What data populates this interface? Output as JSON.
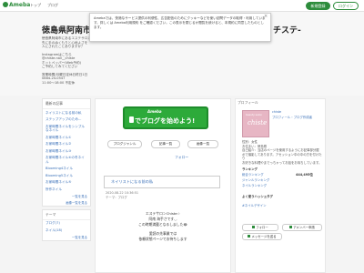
{
  "topbar": {
    "logo": "Ameba",
    "links": [
      "トップ",
      "ブログ"
    ],
    "register": "新規登録",
    "login": "ログイン"
  },
  "notice": {
    "text": "Amebaでは、快適なサービス提供の利便性、広告配信のためにクッキーなどを使い訪問データの取得・利用しています。詳しくは Ameba利用規約 をご確認ください。この表示を閉じるか閲覧を続けると、本規約に同意したものとします。",
    "close": "×"
  },
  "header": {
    "title_left": "徳島県阿南市に",
    "title_right": "チステ-",
    "desc": [
      "徳島県阿南市にあるエステサロン",
      "先に手のぬくもりと心地よさを",
      "人にされたことありますか？",
      "",
      "Instagramはこちら",
      "@chiste.nail__chiste",
      "ホットペッパー(Web予約)",
      "ご予約してみてください",
      "",
      "営業時間/月曜日定休日終日1日",
      "0884-24-0547",
      "11:00〜18:00 不定休"
    ]
  },
  "left": {
    "recent_head": "最新の記事",
    "recent": [
      "ネイリストになる前の私",
      "ステップアップのため…",
      "お家時間ネイルをシンプルなネイル",
      "お家時間ネイル①",
      "お家時間ネイル②",
      "お家時間ネイル③",
      "お家時間ネイル④の冬ネイル",
      "Blooming4ネイル",
      "Blooming5ネイル",
      "お家時間ネイル⑤",
      "所作ネイル"
    ],
    "recent_more": "一覧を見る",
    "recent_images": "画像一覧を見る",
    "theme_head": "テーマ",
    "themes": [
      "ブログ(7)",
      "ネイル(18)"
    ],
    "theme_more": "一覧を見る"
  },
  "center": {
    "banner_top": "Ameba",
    "banner_main": "でブログを始めよう!",
    "buttons": [
      "ブログジャンル",
      "記事一覧",
      "画像一覧"
    ],
    "follow": "フォロー",
    "post_title": "ネイリストになる前の私",
    "post_date": "2020-08-22 10:36:51",
    "post_theme": "テーマ：ブログ",
    "body": [
      "エステサロンChiste☆",
      "阿南 海手さです◡",
      "この時期満載となるしました😂",
      "",
      "愛読の先事業では",
      "依頼状態ページでお待ちします"
    ]
  },
  "right": {
    "profile_head": "プロフィール",
    "profile_img_text": "chiste",
    "profile_img_sub": "beauty salon",
    "name": "chiste",
    "name_sub": "プロフィール・ブログ作成者",
    "info": [
      "性別：女性",
      "お住まい：徳島県",
      "自己紹介：当店のページを使用するようにお記事部分屋ポで撮影してあります。アセッション中の中の方を付けたり",
      "お好きな料理やまでっちゃってお話をお待ちしています。"
    ],
    "ranking_head": "ランキング",
    "ranking": [
      {
        "label": "総合ランキング",
        "value": "444,495位"
      },
      {
        "label": "ジャンルランキング",
        "value": ""
      },
      {
        "label": "ネイルランキング",
        "value": ""
      }
    ],
    "hashtag_head": "よく使うハッシュタグ",
    "hashtags": [
      "#ネイルデザイン"
    ],
    "btn_follow": "フォロー",
    "btn_member": "アメンバー申請",
    "btn_message": "メッセージを送る"
  }
}
